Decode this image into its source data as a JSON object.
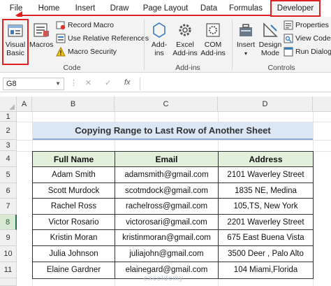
{
  "ribbon": {
    "tabs": [
      {
        "label": "File"
      },
      {
        "label": "Home"
      },
      {
        "label": "Insert"
      },
      {
        "label": "Draw"
      },
      {
        "label": "Page Layout"
      },
      {
        "label": "Data"
      },
      {
        "label": "Formulas"
      },
      {
        "label": "Developer"
      }
    ],
    "active_tab": "Developer",
    "groups": {
      "code": {
        "label": "Code",
        "visual_basic": "Visual Basic",
        "visual_basic_l1": "Visual",
        "visual_basic_l2": "Basic",
        "macros": "Macros",
        "record_macro": "Record Macro",
        "relative_refs": "Use Relative References",
        "macro_security": "Macro Security"
      },
      "addins": {
        "label": "Add-ins",
        "addins_l1": "Add-",
        "addins_l2": "ins",
        "excel_addins_l1": "Excel",
        "excel_addins_l2": "Add-ins",
        "com_addins_l1": "COM",
        "com_addins_l2": "Add-ins"
      },
      "controls": {
        "label": "Controls",
        "insert": "Insert",
        "design_l1": "Design",
        "design_l2": "Mode",
        "properties": "Properties",
        "view_code": "View Code",
        "run_dialog": "Run Dialog"
      }
    }
  },
  "formula_bar": {
    "name_box": "G8",
    "cancel_icon": "✕",
    "enter_icon": "✓",
    "fx_label": "fx",
    "value": ""
  },
  "sheet": {
    "columns": [
      "A",
      "B",
      "C",
      "D"
    ],
    "rows": [
      "1",
      "2",
      "3",
      "4",
      "5",
      "6",
      "7",
      "8",
      "9",
      "10",
      "11"
    ],
    "selected_row": "8",
    "title": "Copying Range to Last Row of Another Sheet",
    "table": {
      "headers": [
        "Full Name",
        "Email",
        "Address"
      ],
      "rows": [
        [
          "Adam Smith",
          "adamsmith@gmail.com",
          "2101 Waverley Street"
        ],
        [
          "Scott Murdock",
          "scotmdock@gmail.com",
          "1835  NE, Medina"
        ],
        [
          "Rachel Ross",
          "rachelross@gmail.com",
          "105,TS, New York"
        ],
        [
          "Victor Rosario",
          "victorosari@gmail.com",
          "2201 Waverley Street"
        ],
        [
          "Kristin Moran",
          "kristinmoran@gmail.com",
          "675 East Buena Vista"
        ],
        [
          "Julia Johnson",
          "juliajohn@gmail.com",
          "3500 Deer , Palo Alto"
        ],
        [
          "Elaine Gardner",
          "elainegard@gmail.com",
          "104 Miami,Florida"
        ]
      ]
    },
    "watermark": "exceldemy"
  },
  "colors": {
    "highlight": "#e02020",
    "title_fill": "#dbe7f5",
    "header_fill": "#e2efda",
    "excel_green": "#217346"
  }
}
